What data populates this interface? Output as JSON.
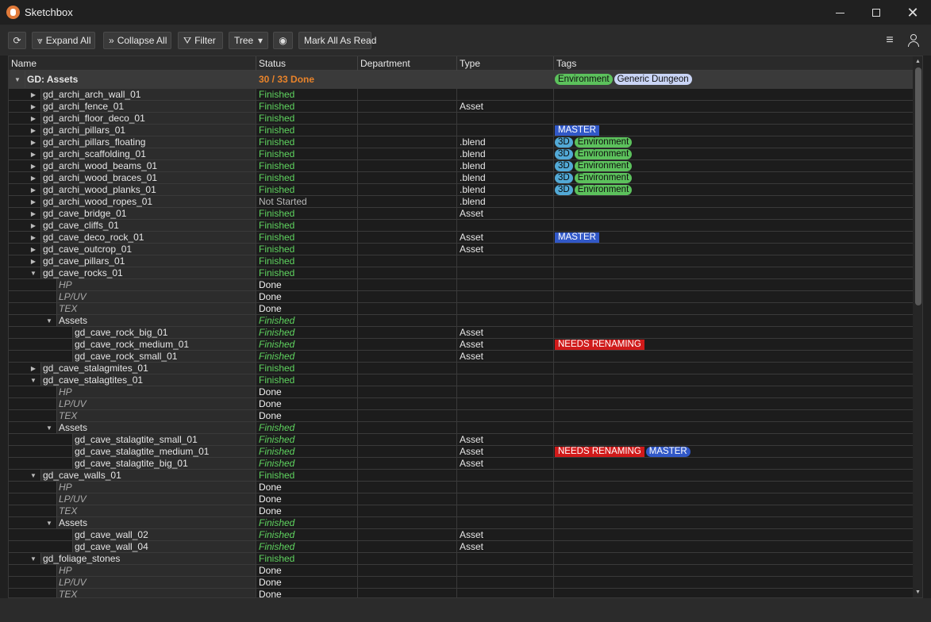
{
  "window": {
    "title": "Sketchbox",
    "min_icon": "minimize-icon",
    "max_icon": "maximize-icon",
    "close_glyph": "✕"
  },
  "toolbar": {
    "refresh_glyph": "⟳",
    "expand_glyph": "⩔",
    "expand_label": "Expand All",
    "collapse_glyph": "»",
    "collapse_label": "Collapse All",
    "filter_glyph": "⛛",
    "filter_label": "Filter",
    "view_mode": "Tree",
    "view_caret": "▾",
    "eye_glyph": "◉",
    "mark_read_label": "Mark All As Read",
    "menu_glyph": "≡"
  },
  "columns": {
    "name": "Name",
    "status": "Status",
    "department": "Department",
    "type": "Type",
    "tags": "Tags"
  },
  "colors": {
    "finished": "#5fd35f",
    "root_status": "#e8832a",
    "environment": "#5cc15c",
    "master": "#3158c7",
    "needs_renaming": "#d01a1a",
    "three_d": "#52a9d6",
    "generic_dungeon": "#c9d4f5"
  },
  "rows": [
    {
      "depth": 0,
      "arrow": "down",
      "name": "GD: Assets",
      "status": "30 / 33 Done",
      "st": "root",
      "type": "",
      "tags": [
        {
          "t": "Environment",
          "k": "env"
        },
        {
          "t": "Generic Dungeon",
          "k": "generic"
        }
      ],
      "root": true
    },
    {
      "depth": 1,
      "arrow": "right",
      "name": "gd_archi_arch_wall_01",
      "status": "Finished",
      "st": "finished",
      "type": "",
      "tags": []
    },
    {
      "depth": 1,
      "arrow": "right",
      "name": "gd_archi_fence_01",
      "status": "Finished",
      "st": "finished",
      "type": "Asset",
      "tags": []
    },
    {
      "depth": 1,
      "arrow": "right",
      "name": "gd_archi_floor_deco_01",
      "status": "Finished",
      "st": "finished",
      "type": "",
      "tags": []
    },
    {
      "depth": 1,
      "arrow": "right",
      "name": "gd_archi_pillars_01",
      "status": "Finished",
      "st": "finished",
      "type": "",
      "tags": [
        {
          "t": "MASTER",
          "k": "master"
        }
      ]
    },
    {
      "depth": 1,
      "arrow": "right",
      "name": "gd_archi_pillars_floating",
      "status": "Finished",
      "st": "finished",
      "type": ".blend",
      "tags": [
        {
          "t": "3D",
          "k": "three-d"
        },
        {
          "t": "Environment",
          "k": "env"
        }
      ]
    },
    {
      "depth": 1,
      "arrow": "right",
      "name": "gd_archi_scaffolding_01",
      "status": "Finished",
      "st": "finished",
      "type": ".blend",
      "tags": [
        {
          "t": "3D",
          "k": "three-d"
        },
        {
          "t": "Environment",
          "k": "env"
        }
      ]
    },
    {
      "depth": 1,
      "arrow": "right",
      "name": "gd_archi_wood_beams_01",
      "status": "Finished",
      "st": "finished",
      "type": ".blend",
      "tags": [
        {
          "t": "3D",
          "k": "three-d"
        },
        {
          "t": "Environment",
          "k": "env"
        }
      ]
    },
    {
      "depth": 1,
      "arrow": "right",
      "name": "gd_archi_wood_braces_01",
      "status": "Finished",
      "st": "finished",
      "type": ".blend",
      "tags": [
        {
          "t": "3D",
          "k": "three-d"
        },
        {
          "t": "Environment",
          "k": "env"
        }
      ]
    },
    {
      "depth": 1,
      "arrow": "right",
      "name": "gd_archi_wood_planks_01",
      "status": "Finished",
      "st": "finished",
      "type": ".blend",
      "tags": [
        {
          "t": "3D",
          "k": "three-d"
        },
        {
          "t": "Environment",
          "k": "env"
        }
      ]
    },
    {
      "depth": 1,
      "arrow": "right",
      "name": "gd_archi_wood_ropes_01",
      "status": "Not Started",
      "st": "notstarted",
      "type": ".blend",
      "tags": []
    },
    {
      "depth": 1,
      "arrow": "right",
      "name": "gd_cave_bridge_01",
      "status": "Finished",
      "st": "finished",
      "type": "Asset",
      "tags": []
    },
    {
      "depth": 1,
      "arrow": "right",
      "name": "gd_cave_cliffs_01",
      "status": "Finished",
      "st": "finished",
      "type": "",
      "tags": []
    },
    {
      "depth": 1,
      "arrow": "right",
      "name": "gd_cave_deco_rock_01",
      "status": "Finished",
      "st": "finished",
      "type": "Asset",
      "tags": [
        {
          "t": "MASTER",
          "k": "master"
        }
      ]
    },
    {
      "depth": 1,
      "arrow": "right",
      "name": "gd_cave_outcrop_01",
      "status": "Finished",
      "st": "finished",
      "type": "Asset",
      "tags": []
    },
    {
      "depth": 1,
      "arrow": "right",
      "name": "gd_cave_pillars_01",
      "status": "Finished",
      "st": "finished",
      "type": "",
      "tags": []
    },
    {
      "depth": 1,
      "arrow": "down",
      "name": "gd_cave_rocks_01",
      "status": "Finished",
      "st": "finished",
      "type": "",
      "tags": []
    },
    {
      "depth": 2,
      "arrow": "",
      "name": "HP",
      "status": "Done",
      "st": "done",
      "type": "",
      "tags": [],
      "sub": true
    },
    {
      "depth": 2,
      "arrow": "",
      "name": "LP/UV",
      "status": "Done",
      "st": "done",
      "type": "",
      "tags": [],
      "sub": true
    },
    {
      "depth": 2,
      "arrow": "",
      "name": "TEX",
      "status": "Done",
      "st": "done",
      "type": "",
      "tags": [],
      "sub": true
    },
    {
      "depth": 2,
      "arrow": "down",
      "name": "Assets",
      "status": "Finished",
      "st": "finished-i",
      "type": "",
      "tags": []
    },
    {
      "depth": 3,
      "arrow": "",
      "name": "gd_cave_rock_big_01",
      "status": "Finished",
      "st": "finished-i",
      "type": "Asset",
      "tags": []
    },
    {
      "depth": 3,
      "arrow": "",
      "name": "gd_cave_rock_medium_01",
      "status": "Finished",
      "st": "finished-i",
      "type": "Asset",
      "tags": [
        {
          "t": "NEEDS RENAMING",
          "k": "rename"
        }
      ]
    },
    {
      "depth": 3,
      "arrow": "",
      "name": "gd_cave_rock_small_01",
      "status": "Finished",
      "st": "finished-i",
      "type": "Asset",
      "tags": []
    },
    {
      "depth": 1,
      "arrow": "right",
      "name": "gd_cave_stalagmites_01",
      "status": "Finished",
      "st": "finished",
      "type": "",
      "tags": []
    },
    {
      "depth": 1,
      "arrow": "down",
      "name": "gd_cave_stalagtites_01",
      "status": "Finished",
      "st": "finished",
      "type": "",
      "tags": []
    },
    {
      "depth": 2,
      "arrow": "",
      "name": "HP",
      "status": "Done",
      "st": "done",
      "type": "",
      "tags": [],
      "sub": true
    },
    {
      "depth": 2,
      "arrow": "",
      "name": "LP/UV",
      "status": "Done",
      "st": "done",
      "type": "",
      "tags": [],
      "sub": true
    },
    {
      "depth": 2,
      "arrow": "",
      "name": "TEX",
      "status": "Done",
      "st": "done",
      "type": "",
      "tags": [],
      "sub": true
    },
    {
      "depth": 2,
      "arrow": "down",
      "name": "Assets",
      "status": "Finished",
      "st": "finished-i",
      "type": "",
      "tags": []
    },
    {
      "depth": 3,
      "arrow": "",
      "name": "gd_cave_stalagtite_small_01",
      "status": "Finished",
      "st": "finished-i",
      "type": "Asset",
      "tags": []
    },
    {
      "depth": 3,
      "arrow": "",
      "name": "gd_cave_stalagtite_medium_01",
      "status": "Finished",
      "st": "finished-i",
      "type": "Asset",
      "tags": [
        {
          "t": "NEEDS RENAMING",
          "k": "rename"
        },
        {
          "t": "MASTER",
          "k": "master round"
        }
      ]
    },
    {
      "depth": 3,
      "arrow": "",
      "name": "gd_cave_stalagtite_big_01",
      "status": "Finished",
      "st": "finished-i",
      "type": "Asset",
      "tags": []
    },
    {
      "depth": 1,
      "arrow": "down",
      "name": "gd_cave_walls_01",
      "status": "Finished",
      "st": "finished",
      "type": "",
      "tags": []
    },
    {
      "depth": 2,
      "arrow": "",
      "name": "HP",
      "status": "Done",
      "st": "done",
      "type": "",
      "tags": [],
      "sub": true
    },
    {
      "depth": 2,
      "arrow": "",
      "name": "LP/UV",
      "status": "Done",
      "st": "done",
      "type": "",
      "tags": [],
      "sub": true
    },
    {
      "depth": 2,
      "arrow": "",
      "name": "TEX",
      "status": "Done",
      "st": "done",
      "type": "",
      "tags": [],
      "sub": true
    },
    {
      "depth": 2,
      "arrow": "down",
      "name": "Assets",
      "status": "Finished",
      "st": "finished-i",
      "type": "",
      "tags": []
    },
    {
      "depth": 3,
      "arrow": "",
      "name": "gd_cave_wall_02",
      "status": "Finished",
      "st": "finished-i",
      "type": "Asset",
      "tags": []
    },
    {
      "depth": 3,
      "arrow": "",
      "name": "gd_cave_wall_04",
      "status": "Finished",
      "st": "finished-i",
      "type": "Asset",
      "tags": []
    },
    {
      "depth": 1,
      "arrow": "down",
      "name": "gd_foliage_stones",
      "status": "Finished",
      "st": "finished",
      "type": "",
      "tags": []
    },
    {
      "depth": 2,
      "arrow": "",
      "name": "HP",
      "status": "Done",
      "st": "done",
      "type": "",
      "tags": [],
      "sub": true
    },
    {
      "depth": 2,
      "arrow": "",
      "name": "LP/UV",
      "status": "Done",
      "st": "done",
      "type": "",
      "tags": [],
      "sub": true
    },
    {
      "depth": 2,
      "arrow": "",
      "name": "TEX",
      "status": "Done",
      "st": "done",
      "type": "",
      "tags": [],
      "sub": true
    }
  ]
}
